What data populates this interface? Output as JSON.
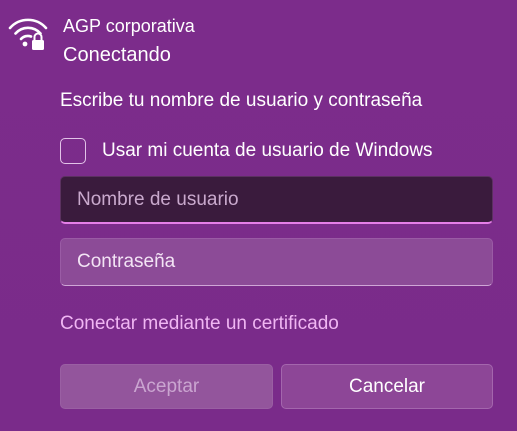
{
  "network": {
    "name": "AGP corporativa",
    "status": "Conectando",
    "icon": "wifi-secured-icon"
  },
  "prompt": "Escribe tu nombre de usuario y contraseña",
  "use_windows_account": {
    "label": "Usar mi cuenta de usuario de Windows",
    "checked": false
  },
  "username": {
    "placeholder": "Nombre de usuario",
    "value": ""
  },
  "password": {
    "placeholder": "Contraseña",
    "value": ""
  },
  "certificate_link": "Conectar mediante un certificado",
  "buttons": {
    "accept": "Aceptar",
    "cancel": "Cancelar"
  },
  "colors": {
    "background": "#7d2a8c",
    "link": "#f0b6f3",
    "focus_accent": "#e57ee8"
  }
}
